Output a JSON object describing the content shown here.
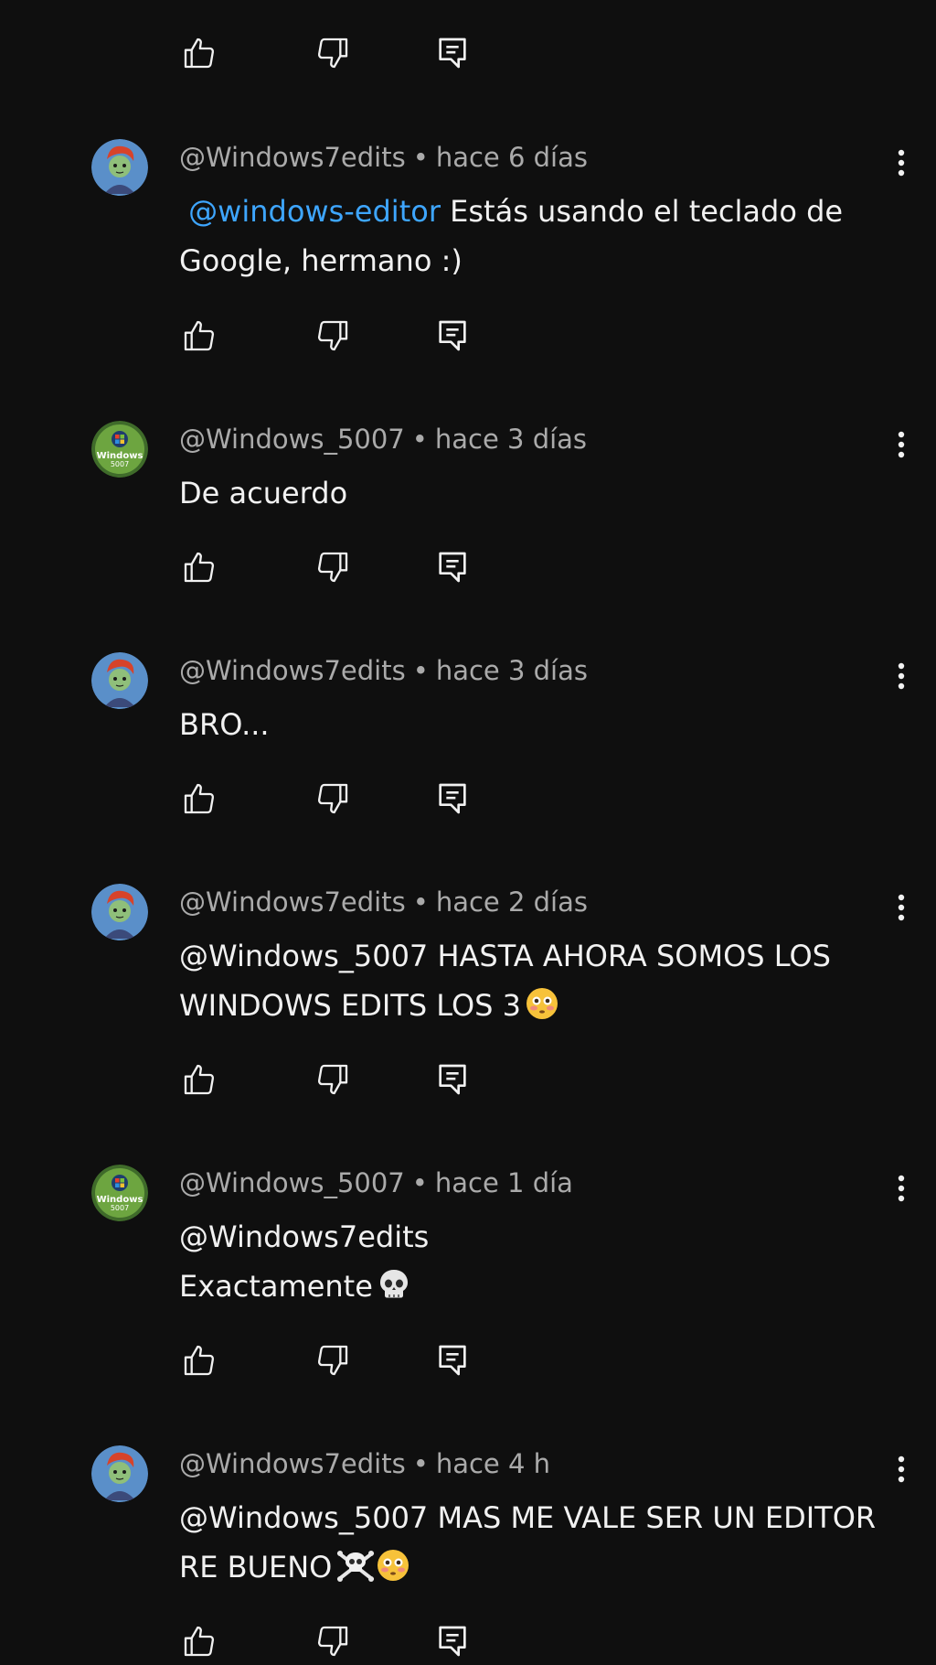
{
  "comments": [
    {
      "author": "@Windows7edits",
      "time": "hace 6 días",
      "mention": "@windows-editor",
      "line1": "Estás usando el teclado de",
      "line2": "Google, hermano :)",
      "avatar": "red-hair-character-avatar"
    },
    {
      "author": "@Windows_5007",
      "time": "hace 3 días",
      "line1": "De acuerdo",
      "avatar": "windows-logo-avatar",
      "avatar_text": [
        "Windows",
        "5007"
      ]
    },
    {
      "author": "@Windows7edits",
      "time": "hace 3 días",
      "line1": "BRO...",
      "avatar": "red-hair-character-avatar"
    },
    {
      "author": "@Windows7edits",
      "time": "hace 2 días",
      "line1": "@Windows_5007 HASTA AHORA SOMOS LOS",
      "line2": "WINDOWS EDITS LOS 3",
      "emoji": "flushed-face",
      "avatar": "red-hair-character-avatar"
    },
    {
      "author": "@Windows_5007",
      "time": "hace 1 día",
      "line1": "@Windows7edits",
      "line2": "Exactamente",
      "emoji": "skull",
      "avatar": "windows-logo-avatar",
      "avatar_text": [
        "Windows",
        "5007"
      ]
    },
    {
      "author": "@Windows7edits",
      "time": "hace 4 h",
      "line1": "@Windows_5007 MAS ME VALE SER UN EDITOR",
      "line2": "RE BUENO",
      "emoji": "skull-crossbones-flushed",
      "avatar": "red-hair-character-avatar"
    }
  ],
  "separator": "•",
  "icons": {
    "like": "thumb-up-icon",
    "dislike": "thumb-down-icon",
    "reply": "reply-icon",
    "more": "more-vert-icon"
  },
  "colors": {
    "background": "#0f0f0f",
    "text": "#f1f1f1",
    "meta": "#aaaaaa",
    "mention": "#3ea6ff"
  }
}
